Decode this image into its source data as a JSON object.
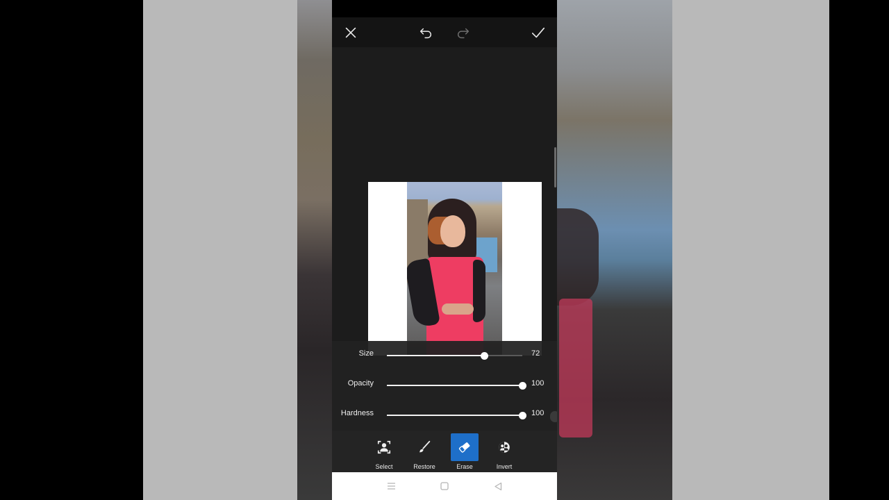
{
  "topbar": {
    "close_icon": "close-icon",
    "undo_icon": "undo-icon",
    "redo_icon": "redo-icon",
    "apply_icon": "check-icon"
  },
  "sliders": [
    {
      "label": "Size",
      "value": "72",
      "level": 0.72
    },
    {
      "label": "Opacity",
      "value": "100",
      "level": 1.0
    },
    {
      "label": "Hardness",
      "value": "100",
      "level": 1.0
    }
  ],
  "tools": [
    {
      "label": "Select",
      "icon": "person-select-icon",
      "active": false
    },
    {
      "label": "Restore",
      "icon": "brush-icon",
      "active": false
    },
    {
      "label": "Erase",
      "icon": "eraser-icon",
      "active": true
    },
    {
      "label": "Invert",
      "icon": "invert-icon",
      "active": false
    }
  ],
  "navbar": {
    "menu_icon": "menu-icon",
    "home_icon": "home-square-icon",
    "back_icon": "back-triangle-icon"
  },
  "colors": {
    "accent": "#1e6fc9",
    "panel": "#1c1c1c",
    "dress": "#ee3d62"
  }
}
